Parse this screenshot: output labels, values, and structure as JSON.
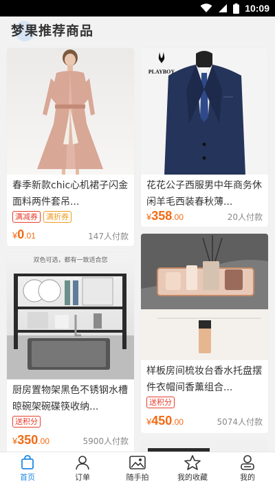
{
  "status_bar": {
    "time": "10:09"
  },
  "header": {
    "title": "梦果推荐商品"
  },
  "products": [
    {
      "name": "春季新款chic心机裙子闪金面料两件套吊...",
      "tags": [
        "满减券",
        "满折券"
      ],
      "price_yen": "¥",
      "price_int": "0",
      "price_dec": ".01",
      "sales": "147人付款"
    },
    {
      "name": "花花公子西服男中年商务休闲羊毛西装春秋薄...",
      "tags": [],
      "price_yen": "¥",
      "price_int": "358",
      "price_dec": ".00",
      "sales": "20人付款",
      "brand_logo_text": "PLAYBOY"
    },
    {
      "name": "厨房置物架黑色不锈钢水槽晾碗架碗碟筷收纳...",
      "tags": [
        "送积分"
      ],
      "price_yen": "¥",
      "price_int": "350",
      "price_dec": ".00",
      "sales": "5900人付款",
      "image_caption": "双色可选，都有一致适合您"
    },
    {
      "name": "样板房间梳妆台香水托盘摆件衣帽间香薰组合...",
      "tags": [
        "送积分"
      ],
      "price_yen": "¥",
      "price_int": "450",
      "price_dec": ".00",
      "sales": "5074人付款"
    }
  ],
  "tabbar": [
    {
      "label": "首页",
      "icon": "home-bag-icon",
      "active": true
    },
    {
      "label": "订单",
      "icon": "person-icon",
      "active": false
    },
    {
      "label": "随手拍",
      "icon": "photo-icon",
      "active": false
    },
    {
      "label": "我的收藏",
      "icon": "star-icon",
      "active": false
    },
    {
      "label": "我的",
      "icon": "user-icon",
      "active": false
    }
  ],
  "colors": {
    "accent": "#1e88e5",
    "price": "#f26a13",
    "tag_red": "#e63c2c",
    "tag_orange": "#f09a1e"
  }
}
